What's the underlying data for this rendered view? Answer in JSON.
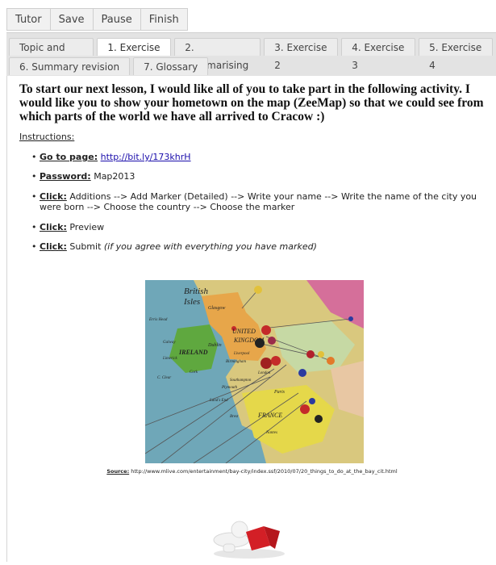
{
  "toolbar": {
    "tutor": "Tutor",
    "save": "Save",
    "pause": "Pause",
    "finish": "Finish"
  },
  "tabs": {
    "row1": [
      "Topic and goals",
      "1. Exercise 1",
      "2. Summarising",
      "3. Exercise 2",
      "4. Exercise 3",
      "5. Exercise 4"
    ],
    "row2": [
      "6. Summary revision",
      "7. Glossary"
    ],
    "active": "1. Exercise 1"
  },
  "intro": "To start our next lesson, I would like all of you to take part in the following activity. I would like you to show your hometown on the map (ZeeMap) so that we could see from which parts of the world we have all arrived to Cracow :)",
  "instructions_heading": "Instructions:",
  "items": [
    {
      "label": "Go to page:",
      "link": "http://bit.ly/173khrH"
    },
    {
      "label": "Password:",
      "text": "Map2013"
    },
    {
      "label": "Click:",
      "text": "Additions --> Add Marker (Detailed) --> Write your name --> Write the name of the city you were born --> Choose the country --> Choose the marker"
    },
    {
      "label": "Click:",
      "text": "Preview"
    },
    {
      "label": "Click:",
      "text": "Submit",
      "note": "(if you agree with everything you have marked)"
    }
  ],
  "image": {
    "map_labels": [
      "British",
      "Isles",
      "Glasgow",
      "UNITED",
      "KINGDOM",
      "IRELAND",
      "Dublin",
      "Galway",
      "Limerick",
      "Cork",
      "Liverpool",
      "London",
      "Birmingham",
      "Southampton",
      "Plymouth",
      "Brest",
      "Paris",
      "FRANCE",
      "Nantes",
      "Erris Head",
      "C. Clear",
      "Land's End"
    ]
  },
  "source": {
    "label": "Source:",
    "url": "http://www.mlive.com/entertainment/bay-city/index.ssf/2010/07/20_things_to_do_at_the_bay_cit.html"
  },
  "colors": {
    "tab_bg": "#e3e3e3",
    "link": "#1a0dab",
    "sea": "#6fa7b8"
  }
}
